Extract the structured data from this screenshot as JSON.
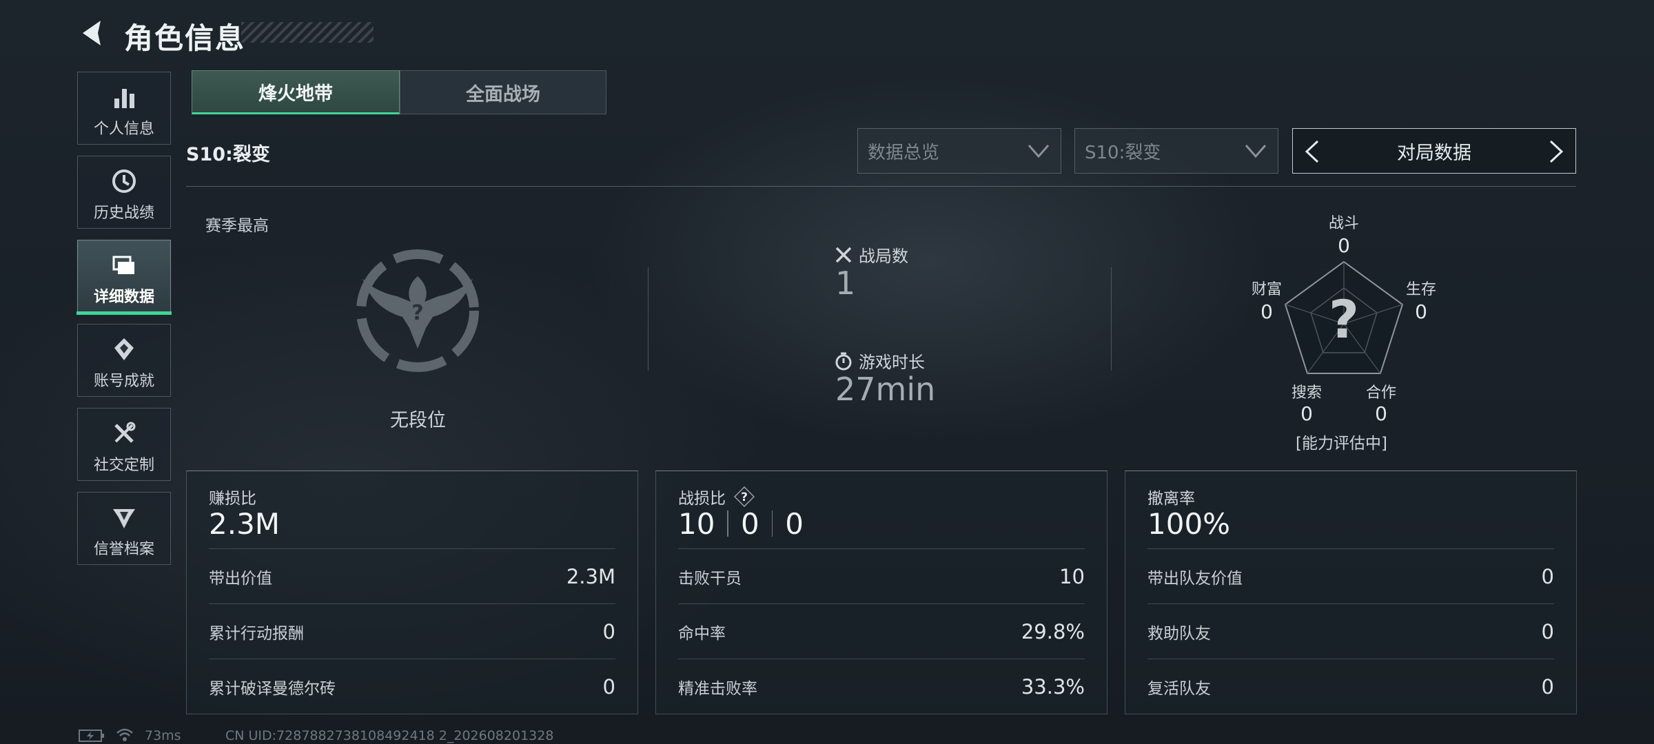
{
  "header": {
    "title": "角色信息"
  },
  "sidebar": {
    "items": [
      {
        "label": "个人信息",
        "icon": "bar-chart-icon"
      },
      {
        "label": "历史战绩",
        "icon": "history-clock-icon"
      },
      {
        "label": "详细数据",
        "icon": "folder-icon",
        "active": true
      },
      {
        "label": "账号成就",
        "icon": "achievement-badge-icon"
      },
      {
        "label": "社交定制",
        "icon": "wrench-screwdriver-icon"
      },
      {
        "label": "信誉档案",
        "icon": "credit-shield-icon"
      }
    ]
  },
  "tabs": [
    {
      "label": "烽火地带",
      "active": true
    },
    {
      "label": "全面战场",
      "active": false
    }
  ],
  "season_label": "S10:裂变",
  "filters": {
    "overview_dropdown": "数据总览",
    "season_dropdown": "S10:裂变",
    "pager_label": "对局数据"
  },
  "season_best": {
    "label": "赛季最高",
    "rank_name": "无段位",
    "emblem_placeholder": "?"
  },
  "stats": {
    "matches_label": "战局数",
    "matches_value": "1",
    "playtime_label": "游戏时长",
    "playtime_value": "27min"
  },
  "radar": {
    "center_mark": "?",
    "status": "[能力评估中]",
    "axes": [
      {
        "label": "战斗",
        "value": "0"
      },
      {
        "label": "生存",
        "value": "0"
      },
      {
        "label": "合作",
        "value": "0"
      },
      {
        "label": "搜索",
        "value": "0"
      },
      {
        "label": "财富",
        "value": "0"
      }
    ]
  },
  "panels": {
    "profit": {
      "title": "赚损比",
      "value": "2.3M",
      "rows": [
        {
          "label": "带出价值",
          "value": "2.3M"
        },
        {
          "label": "累计行动报酬",
          "value": "0"
        },
        {
          "label": "累计破译曼德尔砖",
          "value": "0"
        }
      ]
    },
    "kd": {
      "title": "战损比",
      "help": "?",
      "values": [
        "10",
        "0",
        "0"
      ],
      "rows": [
        {
          "label": "击败干员",
          "value": "10"
        },
        {
          "label": "命中率",
          "value": "29.8%"
        },
        {
          "label": "精准击败率",
          "value": "33.3%"
        }
      ]
    },
    "extract": {
      "title": "撤离率",
      "value": "100%",
      "rows": [
        {
          "label": "带出队友价值",
          "value": "0"
        },
        {
          "label": "救助队友",
          "value": "0"
        },
        {
          "label": "复活队友",
          "value": "0"
        }
      ]
    }
  },
  "footer": {
    "ping": "73ms",
    "uid": "CN UID:7287882738108492418 2_202608201328"
  },
  "colors": {
    "accent": "#3fd59a",
    "background": "#1a2128"
  }
}
